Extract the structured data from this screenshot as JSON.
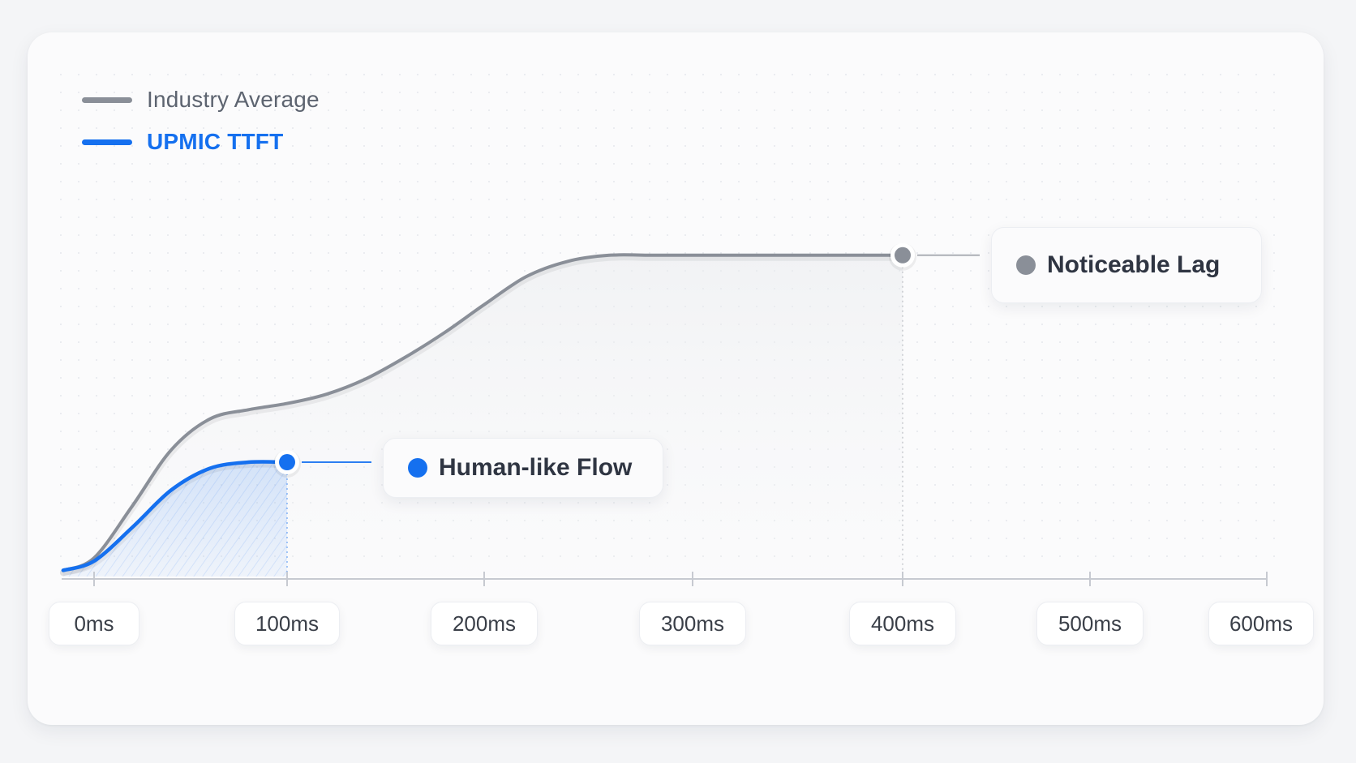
{
  "legend": {
    "industry_label": "Industry Average",
    "upmic_label": "UPMIC TTFT"
  },
  "callouts": {
    "human_label": "Human-like Flow",
    "lag_label": "Noticeable Lag"
  },
  "colors": {
    "industry": "#8a8f98",
    "upmic": "#1570ef",
    "axis": "#c7cad1",
    "grid_dot": "#dfe2e7"
  },
  "chart_data": {
    "type": "line",
    "title": "",
    "xlabel": "",
    "ylabel": "",
    "x_tick_labels": [
      "0ms",
      "100ms",
      "200ms",
      "300ms",
      "400ms",
      "500ms",
      "600ms"
    ],
    "x_ticks": [
      0,
      100,
      200,
      300,
      400,
      500,
      600
    ],
    "xlim": [
      -16,
      608
    ],
    "ylim": [
      0,
      100
    ],
    "grid": "dotted",
    "legend_position": "top-left",
    "series": [
      {
        "name": "Industry Average",
        "x": [
          -16,
          0,
          20,
          40,
          60,
          80,
          100,
          120,
          140,
          160,
          180,
          200,
          220,
          240,
          260,
          280,
          300,
          350,
          400
        ],
        "y": [
          2,
          6,
          23,
          41,
          51,
          54,
          56,
          59,
          64,
          71,
          79,
          88,
          97,
          102,
          104,
          104,
          104,
          104,
          104
        ],
        "end_annotation": "Noticeable Lag",
        "end_x": 400
      },
      {
        "name": "UPMIC TTFT",
        "x": [
          -16,
          0,
          20,
          40,
          60,
          80,
          100
        ],
        "y": [
          2,
          5,
          16,
          28,
          35,
          37,
          37
        ],
        "end_annotation": "Human-like Flow",
        "end_x": 100
      }
    ]
  }
}
